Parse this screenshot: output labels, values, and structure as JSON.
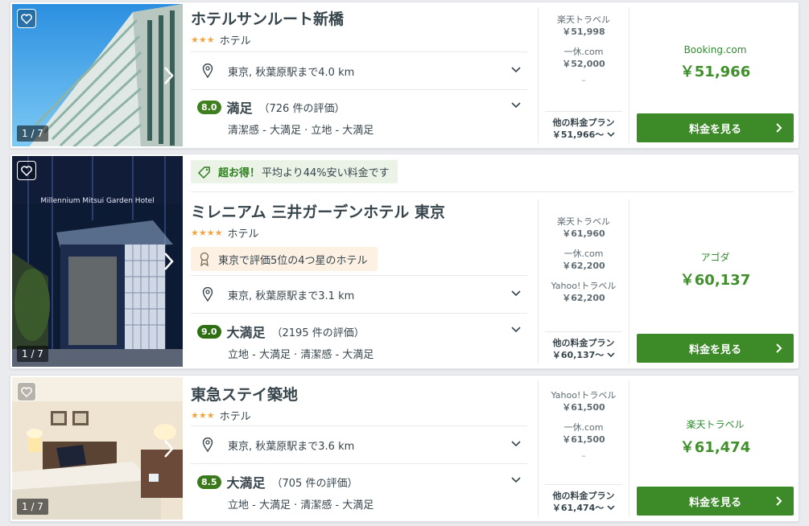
{
  "colors": {
    "accent_green": "#3d8a29",
    "star_orange": "#f2a540",
    "badge_green": "#3e7f1f"
  },
  "hotels": [
    {
      "name": "ホテルサンルート新橋",
      "stars": "★★★",
      "type": "ホテル",
      "photo_counter": "1 / 7",
      "location": "東京, 秋葉原駅まで4.0 km",
      "rating_score": "8.0",
      "rating_word": "満足",
      "rating_count": "（726 件の評価）",
      "rating_details": "清潔感 - 大満足 · 立地 - 大満足",
      "partners": [
        {
          "name": "楽天トラベル",
          "price": "￥51,998"
        },
        {
          "name": "一休.com",
          "price": "￥52,000"
        }
      ],
      "partner_dash": "–",
      "other_plans_label": "他の料金プラン",
      "other_plans_price": "￥51,966〜",
      "deal_source": "Booking.com",
      "deal_price": "￥51,966",
      "button_label": "料金を見る"
    },
    {
      "promo_strong": "超お得！",
      "promo_text": "平均より44%安い料金です",
      "name": "ミレニアム 三井ガーデンホテル 東京",
      "stars": "★★★★",
      "type": "ホテル",
      "award": "東京で評価5位の4つ星のホテル",
      "photo_sign": "Millennium Mitsui Garden Hotel",
      "photo_counter": "1 / 7",
      "location": "東京, 秋葉原駅まで3.1 km",
      "rating_score": "9.0",
      "rating_word": "大満足",
      "rating_count": "（2195 件の評価）",
      "rating_details": "立地 - 大満足 · 清潔感 - 大満足",
      "partners": [
        {
          "name": "楽天トラベル",
          "price": "￥61,960"
        },
        {
          "name": "一休.com",
          "price": "￥62,200"
        },
        {
          "name": "Yahoo!トラベル",
          "price": "￥62,200"
        }
      ],
      "other_plans_label": "他の料金プラン",
      "other_plans_price": "￥60,137〜",
      "deal_source": "アゴダ",
      "deal_price": "￥60,137",
      "button_label": "料金を見る"
    },
    {
      "name": "東急ステイ築地",
      "stars": "★★★",
      "type": "ホテル",
      "photo_counter": "1 / 7",
      "location": "東京, 秋葉原駅まで3.6 km",
      "rating_score": "8.5",
      "rating_word": "大満足",
      "rating_count": "（705 件の評価）",
      "rating_details": "立地 - 大満足 · 清潔感 - 大満足",
      "partners": [
        {
          "name": "Yahoo!トラベル",
          "price": "￥61,500"
        },
        {
          "name": "一休.com",
          "price": "￥61,500"
        }
      ],
      "partner_dash": "–",
      "other_plans_label": "他の料金プラン",
      "other_plans_price": "￥61,474〜",
      "deal_source": "楽天トラベル",
      "deal_price": "￥61,474",
      "button_label": "料金を見る"
    }
  ]
}
